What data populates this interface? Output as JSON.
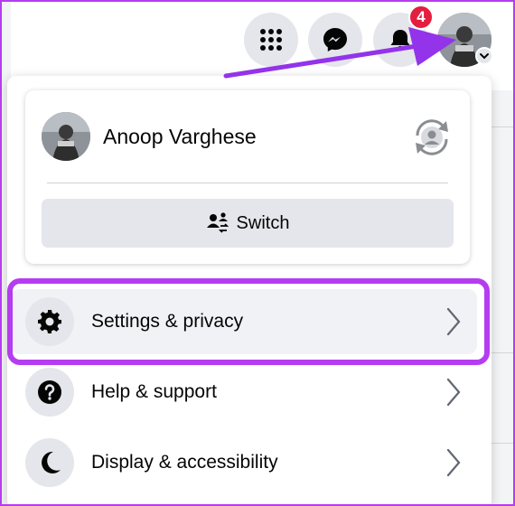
{
  "topbar": {
    "menu_icon": "grid-menu-icon",
    "messenger_icon": "messenger-icon",
    "notifications_icon": "bell-icon",
    "notification_count": "4"
  },
  "profile": {
    "name": "Anoop Varghese",
    "switch_label": "Switch"
  },
  "menu": {
    "items": [
      {
        "label": "Settings & privacy",
        "icon": "gear-icon"
      },
      {
        "label": "Help & support",
        "icon": "question-icon"
      },
      {
        "label": "Display & accessibility",
        "icon": "moon-icon"
      }
    ]
  },
  "colors": {
    "highlight": "#b53cf0",
    "badge": "#e41e3f",
    "button_bg": "#e4e6eb"
  }
}
